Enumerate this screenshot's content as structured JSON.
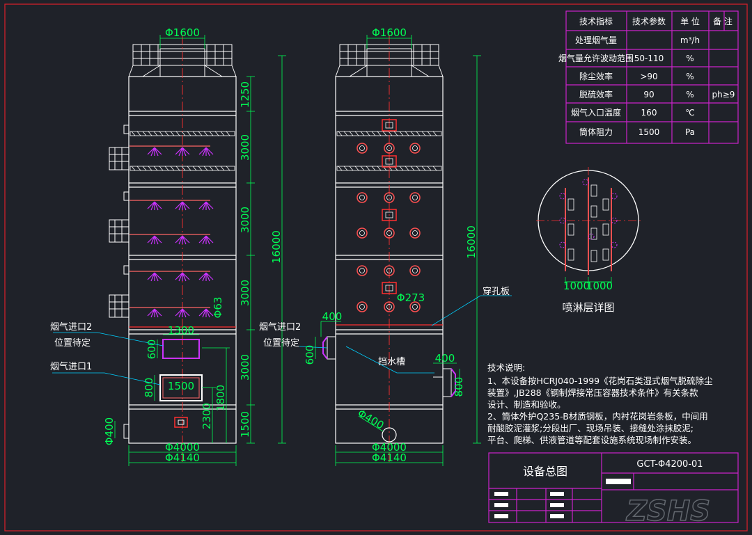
{
  "spec_table": {
    "headers": [
      "技术指标",
      "技术参数",
      "单 位",
      "备 注"
    ],
    "rows": [
      {
        "name": "处理烟气量",
        "value": "",
        "unit": "m³/h",
        "note": ""
      },
      {
        "name": "烟气量允许波动范围",
        "value": "50-110",
        "unit": "%",
        "note": ""
      },
      {
        "name": "除尘效率",
        "value": ">90",
        "unit": "%",
        "note": ""
      },
      {
        "name": "脱硫效率",
        "value": "90",
        "unit": "%",
        "note": "ph≥9"
      },
      {
        "name": "烟气入口温度",
        "value": "160",
        "unit": "℃",
        "note": ""
      },
      {
        "name": "筒体阻力",
        "value": "1500",
        "unit": "Pa",
        "note": ""
      }
    ]
  },
  "left_view": {
    "top_dia": "Φ1600",
    "dims_right": [
      "1250",
      "3000",
      "3000",
      "3000",
      "3000",
      "1500"
    ],
    "total_height": "16000",
    "inlet2_width": "1300",
    "inlet2_height": "600",
    "inlet1_width": "1500",
    "inlet1_height": "800",
    "dim_1800": "1800",
    "dim_2300": "2300",
    "dim_phi63": "Φ63",
    "dim_phi400": "Φ400",
    "bottom_inner": "Φ4000",
    "bottom_outer": "Φ4140",
    "label_inlet2_a": "烟气进口2",
    "label_inlet2_b": "位置待定",
    "label_inlet1": "烟气进口1"
  },
  "right_view": {
    "top_dia": "Φ1600",
    "total_height": "16000",
    "dim_phi273": "Φ273",
    "dim_400a": "400",
    "dim_600": "600",
    "dim_400b": "400",
    "dim_800": "800",
    "dim_phi400": "Φ400",
    "bottom_inner": "Φ4000",
    "bottom_outer": "Φ4140",
    "label_perforated": "穿孔板",
    "label_baffle": "挡水槽",
    "label_inlet2_a": "烟气进口2",
    "label_inlet2_b": "位置待定"
  },
  "spray_detail": {
    "title": "喷淋层详图",
    "dim_a": "1000",
    "dim_b": "1000"
  },
  "tech_notes": {
    "title": "技术说明:",
    "lines": [
      "1、本设备按HCRJ040-1999《花岗石类湿式烟气脱硫除尘",
      "装置》,JB288《钢制焊接常压容器技术条件》有关条款",
      "设计、制造和验收。",
      "2、筒体外护Q235-B材质钢板，内衬花岗岩条板，中间用",
      "耐酸胶泥灌浆;分段出厂、现场吊装、接缝处涂抹胶泥;",
      "平台、爬梯、供液管道等配套设施系统现场制作安装。"
    ]
  },
  "title_block": {
    "drawing_name": "设备总图",
    "drawing_number": "GCT-Φ4200-01"
  },
  "watermark": "ZSHS",
  "colors": {
    "background": "#1f2229",
    "frame": "#d0202a",
    "outline": "#ffffff",
    "dimension": "#00ff55",
    "centerline": "#ff3030",
    "spray": "#cc33ff",
    "table_border": "#cc22cc"
  }
}
